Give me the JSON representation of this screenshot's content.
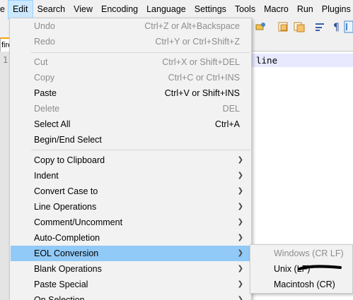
{
  "menubar": {
    "items": [
      "e",
      "Edit",
      "Search",
      "View",
      "Encoding",
      "Language",
      "Settings",
      "Tools",
      "Macro",
      "Run",
      "Plugins"
    ],
    "active_index": 1
  },
  "toolbar": {
    "icons": [
      "find-replace-icon",
      "save-icon",
      "copy-icon",
      "wrap-icon",
      "show-all-chars-icon",
      "indent-guide-icon"
    ]
  },
  "tab": {
    "label": "fire"
  },
  "editor": {
    "line_number": "1",
    "text": "line"
  },
  "edit_menu": {
    "items": [
      {
        "label": "Undo",
        "shortcut": "Ctrl+Z or Alt+Backspace",
        "enabled": false
      },
      {
        "label": "Redo",
        "shortcut": "Ctrl+Y or Ctrl+Shift+Z",
        "enabled": false
      },
      {
        "label": "Cut",
        "shortcut": "Ctrl+X or Shift+DEL",
        "enabled": false
      },
      {
        "label": "Copy",
        "shortcut": "Ctrl+C or Ctrl+INS",
        "enabled": false
      },
      {
        "label": "Paste",
        "shortcut": "Ctrl+V or Shift+INS",
        "enabled": true
      },
      {
        "label": "Delete",
        "shortcut": "DEL",
        "enabled": false
      },
      {
        "label": "Select All",
        "shortcut": "Ctrl+A",
        "enabled": true
      },
      {
        "label": "Begin/End Select",
        "shortcut": "",
        "enabled": true
      },
      {
        "label": "Copy to Clipboard",
        "submenu": true
      },
      {
        "label": "Indent",
        "submenu": true
      },
      {
        "label": "Convert Case to",
        "submenu": true
      },
      {
        "label": "Line Operations",
        "submenu": true
      },
      {
        "label": "Comment/Uncomment",
        "submenu": true
      },
      {
        "label": "Auto-Completion",
        "submenu": true
      },
      {
        "label": "EOL Conversion",
        "submenu": true,
        "highlighted": true
      },
      {
        "label": "Blank Operations",
        "submenu": true
      },
      {
        "label": "Paste Special",
        "submenu": true
      },
      {
        "label": "On Selection",
        "submenu": true
      }
    ]
  },
  "eol_submenu": {
    "items": [
      {
        "label": "Windows (CR LF)",
        "enabled": false
      },
      {
        "label": "Unix (LF)",
        "enabled": true
      },
      {
        "label": "Macintosh (CR)",
        "enabled": true
      }
    ]
  },
  "colors": {
    "highlight": "#91c9f7",
    "menu_bg": "#f2f2f2",
    "disabled_text": "#8d8d8d",
    "active_menubar": "#cce8ff"
  }
}
